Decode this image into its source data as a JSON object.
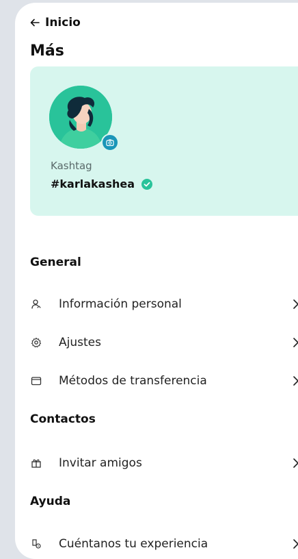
{
  "header": {
    "back_label": "Inicio",
    "title": "Más"
  },
  "profile": {
    "kashtag_label": "Kashtag",
    "handle": "#karlakashea"
  },
  "sections": {
    "general": {
      "title": "General",
      "items": [
        {
          "label": "Información personal",
          "icon": "user-icon"
        },
        {
          "label": "Ajustes",
          "icon": "gear-icon"
        },
        {
          "label": "Métodos de transferencia",
          "icon": "wallet-icon"
        }
      ]
    },
    "contactos": {
      "title": "Contactos",
      "items": [
        {
          "label": "Invitar amigos",
          "icon": "gift-icon"
        }
      ]
    },
    "ayuda": {
      "title": "Ayuda",
      "items": [
        {
          "label": "Cuéntanos tu experiencia",
          "icon": "feedback-icon"
        }
      ]
    }
  },
  "colors": {
    "card_bg": "#d7f6ee",
    "accent_green": "#29c39a",
    "badge_blue": "#1a96b8"
  }
}
